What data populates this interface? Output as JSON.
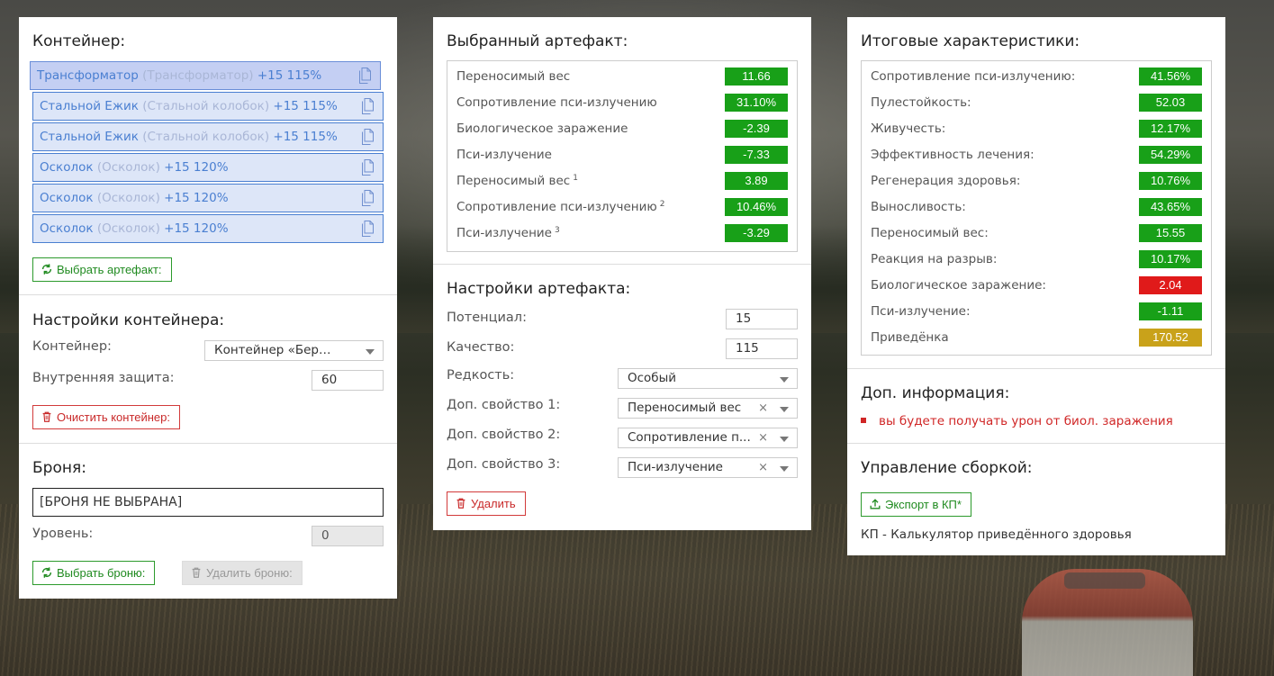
{
  "container_panel": {
    "title": "Контейнер:",
    "slots": [
      {
        "name": "Трансформатор",
        "alt": "(Трансформатор)",
        "level": "+15 115%",
        "selected": true
      },
      {
        "name": "Стальной Ежик",
        "alt": "(Стальной колобок)",
        "level": "+15 115%",
        "selected": false
      },
      {
        "name": "Стальной Ежик",
        "alt": "(Стальной колобок)",
        "level": "+15 115%",
        "selected": false
      },
      {
        "name": "Осколок",
        "alt": "(Осколок)",
        "level": "+15 120%",
        "selected": false
      },
      {
        "name": "Осколок",
        "alt": "(Осколок)",
        "level": "+15 120%",
        "selected": false
      },
      {
        "name": "Осколок",
        "alt": "(Осколок)",
        "level": "+15 120%",
        "selected": false
      }
    ],
    "choose_artifact_button": "Выбрать артефакт:",
    "settings_title": "Настройки контейнера:",
    "container_label": "Контейнер:",
    "container_value": "Контейнер «Берлога…",
    "protection_label": "Внутренняя защита:",
    "protection_value": "60",
    "clear_button": "Очистить контейнер:",
    "armor_title": "Броня:",
    "armor_value": "[БРОНЯ НЕ ВЫБРАНА]",
    "level_label": "Уровень:",
    "level_value": "0",
    "choose_armor_button": "Выбрать броню:",
    "delete_armor_button": "Удалить броню:"
  },
  "artifact_panel": {
    "title": "Выбранный артефакт:",
    "stats": [
      {
        "name": "Переносимый вес",
        "sup": "",
        "value": "11.66",
        "color": "green"
      },
      {
        "name": "Сопротивление пси-излучению",
        "sup": "",
        "value": "31.10%",
        "color": "green"
      },
      {
        "name": "Биологическое заражение",
        "sup": "",
        "value": "-2.39",
        "color": "green"
      },
      {
        "name": "Пси-излучение",
        "sup": "",
        "value": "-7.33",
        "color": "green"
      },
      {
        "name": "Переносимый вес",
        "sup": "1",
        "value": "3.89",
        "color": "green"
      },
      {
        "name": "Сопротивление пси-излучению",
        "sup": "2",
        "value": "10.46%",
        "color": "green"
      },
      {
        "name": "Пси-излучение",
        "sup": "3",
        "value": "-3.29",
        "color": "green"
      }
    ],
    "settings_title": "Настройки артефакта:",
    "potential_label": "Потенциал:",
    "potential_value": "15",
    "quality_label": "Качество:",
    "quality_value": "115",
    "rarity_label": "Редкость:",
    "rarity_value": "Особый",
    "extra1_label": "Доп. свойство 1:",
    "extra1_value": "Переносимый вес",
    "extra2_label": "Доп. свойство 2:",
    "extra2_value": "Сопротивление п...",
    "extra3_label": "Доп. свойство 3:",
    "extra3_value": "Пси-излучение",
    "clear_symbol": "×",
    "delete_button": "Удалить"
  },
  "totals_panel": {
    "title": "Итоговые характеристики:",
    "stats": [
      {
        "name": "Сопротивление пси-излучению:",
        "value": "41.56%",
        "color": "green"
      },
      {
        "name": "Пулестойкость:",
        "value": "52.03",
        "color": "green"
      },
      {
        "name": "Живучесть:",
        "value": "12.17%",
        "color": "green"
      },
      {
        "name": "Эффективность лечения:",
        "value": "54.29%",
        "color": "green"
      },
      {
        "name": "Регенерация здоровья:",
        "value": "10.76%",
        "color": "green"
      },
      {
        "name": "Выносливость:",
        "value": "43.65%",
        "color": "green"
      },
      {
        "name": "Переносимый вес:",
        "value": "15.55",
        "color": "green"
      },
      {
        "name": "Реакция на разрыв:",
        "value": "10.17%",
        "color": "green"
      },
      {
        "name": "Биологическое заражение:",
        "value": "2.04",
        "color": "red"
      },
      {
        "name": "Пси-излучение:",
        "value": "-1.11",
        "color": "green"
      },
      {
        "name": "Приведёнка",
        "value": "170.52",
        "color": "gold"
      }
    ],
    "info_title": "Доп. информация:",
    "info_items": [
      "вы будете получать урон от биол. заражения"
    ],
    "build_title": "Управление сборкой:",
    "export_button": "Экспорт в КП*",
    "footnote": "КП - Калькулятор приведённого здоровья"
  },
  "colors": {
    "green": "#18a018",
    "red": "#e01a1a",
    "gold": "#c9a21a",
    "slot_border": "#4a7fd1",
    "slot_bg": "#dde6f8"
  }
}
